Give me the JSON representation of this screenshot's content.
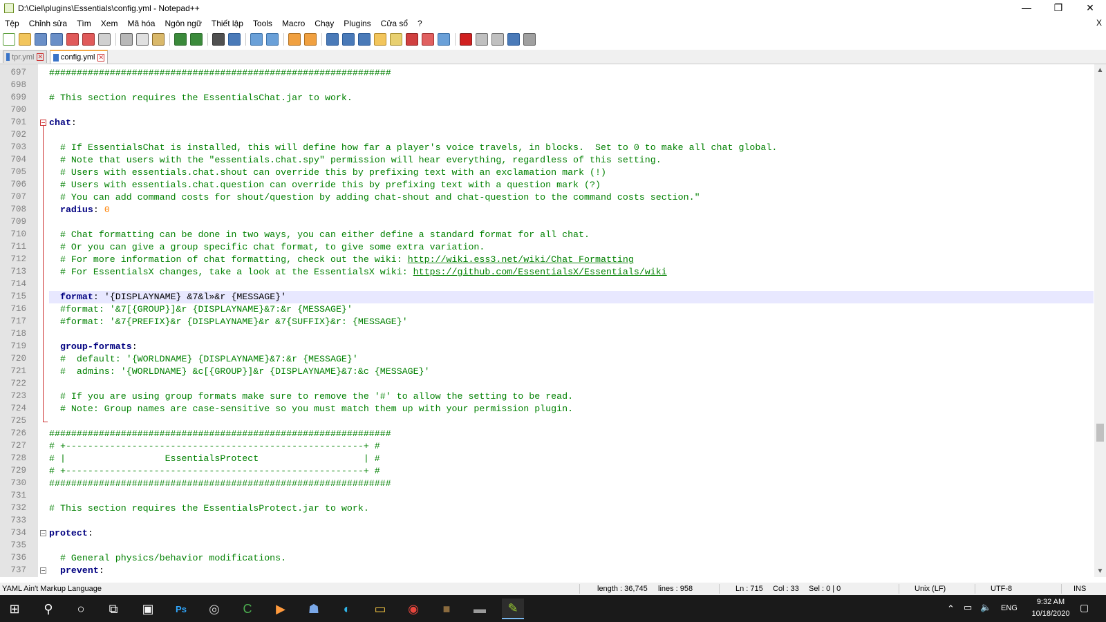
{
  "window": {
    "title": "D:\\Ciel\\plugins\\Essentials\\config.yml - Notepad++",
    "minimize": "—",
    "restore": "❐",
    "close": "✕"
  },
  "menu": {
    "items": [
      "Tệp",
      "Chỉnh sửa",
      "Tìm",
      "Xem",
      "Mã hóa",
      "Ngôn ngữ",
      "Thiết lập",
      "Tools",
      "Macro",
      "Chạy",
      "Plugins",
      "Cửa sổ",
      "?"
    ],
    "close_doc": "X"
  },
  "toolbar": {
    "buttons": [
      {
        "name": "new-file-icon",
        "color": "#ffffff",
        "border": "#5a9e3a"
      },
      {
        "name": "open-file-icon",
        "color": "#f2c55c",
        "border": "#b58a2a"
      },
      {
        "name": "save-icon",
        "color": "#6a8fc7",
        "border": "#3a5f97"
      },
      {
        "name": "save-all-icon",
        "color": "#6a8fc7",
        "border": "#3a5f97"
      },
      {
        "name": "close-file-icon",
        "color": "#e05a5a",
        "border": "#a03030"
      },
      {
        "name": "close-all-icon",
        "color": "#e05a5a",
        "border": "#a03030"
      },
      {
        "name": "print-icon",
        "color": "#d0d0d0",
        "border": "#707070"
      },
      {
        "name": "sep"
      },
      {
        "name": "cut-icon",
        "color": "#b8b8b8",
        "border": "#606060"
      },
      {
        "name": "copy-icon",
        "color": "#e0e0e0",
        "border": "#707070"
      },
      {
        "name": "paste-icon",
        "color": "#d9b86a",
        "border": "#8a6a2a"
      },
      {
        "name": "sep"
      },
      {
        "name": "undo-icon",
        "color": "#3b8a3b",
        "border": "#2a6a2a"
      },
      {
        "name": "redo-icon",
        "color": "#3b8a3b",
        "border": "#2a6a2a"
      },
      {
        "name": "sep"
      },
      {
        "name": "find-icon",
        "color": "#505050",
        "border": "#303030"
      },
      {
        "name": "replace-icon",
        "color": "#4a7ab8",
        "border": "#2a5a98"
      },
      {
        "name": "sep"
      },
      {
        "name": "zoom-in-icon",
        "color": "#6aa0d8",
        "border": "#3a70a8"
      },
      {
        "name": "zoom-out-icon",
        "color": "#6aa0d8",
        "border": "#3a70a8"
      },
      {
        "name": "sep"
      },
      {
        "name": "sync-vertical-icon",
        "color": "#f0a040",
        "border": "#b07020"
      },
      {
        "name": "sync-horizontal-icon",
        "color": "#f0a040",
        "border": "#b07020"
      },
      {
        "name": "sep"
      },
      {
        "name": "word-wrap-icon",
        "color": "#4a7ab8",
        "border": "#2a5a98"
      },
      {
        "name": "show-all-chars-icon",
        "color": "#4a7ab8",
        "border": "#2a5a98"
      },
      {
        "name": "indent-guide-icon",
        "color": "#4a7ab8",
        "border": "#2a5a98"
      },
      {
        "name": "user-language-icon",
        "color": "#f2c55c",
        "border": "#b58a2a"
      },
      {
        "name": "doc-map-icon",
        "color": "#e8d070",
        "border": "#a89030"
      },
      {
        "name": "function-list-icon",
        "color": "#d04040",
        "border": "#902020"
      },
      {
        "name": "folder-workspace-icon",
        "color": "#e06060",
        "border": "#a03030"
      },
      {
        "name": "monitoring-icon",
        "color": "#6aa0d8",
        "border": "#3a70a8"
      },
      {
        "name": "sep"
      },
      {
        "name": "record-macro-icon",
        "color": "#d02020",
        "border": "#802020"
      },
      {
        "name": "stop-record-icon",
        "color": "#c0c0c0",
        "border": "#707070"
      },
      {
        "name": "play-macro-icon",
        "color": "#c0c0c0",
        "border": "#707070"
      },
      {
        "name": "run-macro-multiple-icon",
        "color": "#4a7ab8",
        "border": "#2a5a98"
      },
      {
        "name": "save-macro-icon",
        "color": "#a0a0a0",
        "border": "#606060"
      }
    ]
  },
  "tabs": [
    {
      "label": "tpr.yml",
      "active": false
    },
    {
      "label": "config.yml",
      "active": true
    }
  ],
  "editor": {
    "lines": [
      {
        "n": "697",
        "fold": "line",
        "parts": [
          [
            "c-com",
            "##############################################################"
          ]
        ]
      },
      {
        "n": "698",
        "fold": "line",
        "parts": []
      },
      {
        "n": "699",
        "fold": "line",
        "parts": [
          [
            "c-com",
            "# This section requires the EssentialsChat.jar to work."
          ]
        ]
      },
      {
        "n": "700",
        "fold": "line",
        "parts": []
      },
      {
        "n": "701",
        "fold": "box",
        "parts": [
          [
            "c-key",
            "chat"
          ],
          [
            "c-str",
            ":"
          ]
        ]
      },
      {
        "n": "702",
        "fold": "line",
        "parts": []
      },
      {
        "n": "703",
        "fold": "line",
        "parts": [
          [
            "c-str",
            "  "
          ],
          [
            "c-com",
            "# If EssentialsChat is installed, this will define how far a player's voice travels, in blocks.  Set to 0 to make all chat global."
          ]
        ]
      },
      {
        "n": "704",
        "fold": "line",
        "parts": [
          [
            "c-str",
            "  "
          ],
          [
            "c-com",
            "# Note that users with the \"essentials.chat.spy\" permission will hear everything, regardless of this setting."
          ]
        ]
      },
      {
        "n": "705",
        "fold": "line",
        "parts": [
          [
            "c-str",
            "  "
          ],
          [
            "c-com",
            "# Users with essentials.chat.shout can override this by prefixing text with an exclamation mark (!)"
          ]
        ]
      },
      {
        "n": "706",
        "fold": "line",
        "parts": [
          [
            "c-str",
            "  "
          ],
          [
            "c-com",
            "# Users with essentials.chat.question can override this by prefixing text with a question mark (?)"
          ]
        ]
      },
      {
        "n": "707",
        "fold": "line",
        "parts": [
          [
            "c-str",
            "  "
          ],
          [
            "c-com",
            "# You can add command costs for shout/question by adding chat-shout and chat-question to the command costs section.\""
          ]
        ]
      },
      {
        "n": "708",
        "fold": "line",
        "parts": [
          [
            "c-str",
            "  "
          ],
          [
            "c-key",
            "radius"
          ],
          [
            "c-str",
            ": "
          ],
          [
            "c-num",
            "0"
          ]
        ]
      },
      {
        "n": "709",
        "fold": "line",
        "parts": []
      },
      {
        "n": "710",
        "fold": "line",
        "parts": [
          [
            "c-str",
            "  "
          ],
          [
            "c-com",
            "# Chat formatting can be done in two ways, you can either define a standard format for all chat."
          ]
        ]
      },
      {
        "n": "711",
        "fold": "line",
        "parts": [
          [
            "c-str",
            "  "
          ],
          [
            "c-com",
            "# Or you can give a group specific chat format, to give some extra variation."
          ]
        ]
      },
      {
        "n": "712",
        "fold": "line",
        "parts": [
          [
            "c-str",
            "  "
          ],
          [
            "c-com",
            "# For more information of chat formatting, check out the wiki: "
          ],
          [
            "c-url",
            "http://wiki.ess3.net/wiki/Chat_Formatting"
          ]
        ]
      },
      {
        "n": "713",
        "fold": "line",
        "parts": [
          [
            "c-str",
            "  "
          ],
          [
            "c-com",
            "# For EssentialsX changes, take a look at the EssentialsX wiki: "
          ],
          [
            "c-url",
            "https://github.com/EssentialsX/Essentials/wiki"
          ]
        ]
      },
      {
        "n": "714",
        "fold": "line",
        "parts": []
      },
      {
        "n": "715",
        "fold": "line",
        "cur": true,
        "parts": [
          [
            "c-str",
            "  "
          ],
          [
            "c-key",
            "format"
          ],
          [
            "c-str",
            ": '{DISPLAYNAME} &7&l»&r {MESSAGE}'"
          ]
        ]
      },
      {
        "n": "716",
        "fold": "line",
        "parts": [
          [
            "c-str",
            "  "
          ],
          [
            "c-com",
            "#format: '&7[{GROUP}]&r {DISPLAYNAME}&7:&r {MESSAGE}'"
          ]
        ]
      },
      {
        "n": "717",
        "fold": "line",
        "parts": [
          [
            "c-str",
            "  "
          ],
          [
            "c-com",
            "#format: '&7{PREFIX}&r {DISPLAYNAME}&r &7{SUFFIX}&r: {MESSAGE}'"
          ]
        ]
      },
      {
        "n": "718",
        "fold": "line",
        "parts": []
      },
      {
        "n": "719",
        "fold": "line",
        "parts": [
          [
            "c-str",
            "  "
          ],
          [
            "c-key",
            "group-formats"
          ],
          [
            "c-str",
            ":"
          ]
        ]
      },
      {
        "n": "720",
        "fold": "line",
        "parts": [
          [
            "c-str",
            "  "
          ],
          [
            "c-com",
            "#  default: '{WORLDNAME} {DISPLAYNAME}&7:&r {MESSAGE}'"
          ]
        ]
      },
      {
        "n": "721",
        "fold": "line",
        "parts": [
          [
            "c-str",
            "  "
          ],
          [
            "c-com",
            "#  admins: '{WORLDNAME} &c[{GROUP}]&r {DISPLAYNAME}&7:&c {MESSAGE}'"
          ]
        ]
      },
      {
        "n": "722",
        "fold": "line",
        "parts": []
      },
      {
        "n": "723",
        "fold": "line",
        "parts": [
          [
            "c-str",
            "  "
          ],
          [
            "c-com",
            "# If you are using group formats make sure to remove the '#' to allow the setting to be read."
          ]
        ]
      },
      {
        "n": "724",
        "fold": "line",
        "parts": [
          [
            "c-str",
            "  "
          ],
          [
            "c-com",
            "# Note: Group names are case-sensitive so you must match them up with your permission plugin."
          ]
        ]
      },
      {
        "n": "725",
        "fold": "end",
        "parts": []
      },
      {
        "n": "726",
        "fold": "none",
        "parts": [
          [
            "c-com",
            "##############################################################"
          ]
        ]
      },
      {
        "n": "727",
        "fold": "none",
        "parts": [
          [
            "c-com",
            "# +------------------------------------------------------+ #"
          ]
        ]
      },
      {
        "n": "728",
        "fold": "none",
        "parts": [
          [
            "c-com",
            "# |                  EssentialsProtect                   | #"
          ]
        ]
      },
      {
        "n": "729",
        "fold": "none",
        "parts": [
          [
            "c-com",
            "# +------------------------------------------------------+ #"
          ]
        ]
      },
      {
        "n": "730",
        "fold": "none",
        "parts": [
          [
            "c-com",
            "##############################################################"
          ]
        ]
      },
      {
        "n": "731",
        "fold": "none",
        "parts": []
      },
      {
        "n": "732",
        "fold": "none",
        "parts": [
          [
            "c-com",
            "# This section requires the EssentialsProtect.jar to work."
          ]
        ]
      },
      {
        "n": "733",
        "fold": "none",
        "parts": []
      },
      {
        "n": "734",
        "fold": "graybox",
        "parts": [
          [
            "c-key",
            "protect"
          ],
          [
            "c-str",
            ":"
          ]
        ]
      },
      {
        "n": "735",
        "fold": "none",
        "parts": []
      },
      {
        "n": "736",
        "fold": "none",
        "parts": [
          [
            "c-str",
            "  "
          ],
          [
            "c-com",
            "# General physics/behavior modifications."
          ]
        ]
      },
      {
        "n": "737",
        "fold": "graybox",
        "parts": [
          [
            "c-str",
            "  "
          ],
          [
            "c-key",
            "prevent"
          ],
          [
            "c-str",
            ":"
          ]
        ]
      }
    ]
  },
  "status": {
    "language": "YAML Ain't Markup Language",
    "length": "length : 36,745",
    "lines": "lines : 958",
    "ln": "Ln : 715",
    "col": "Col : 33",
    "sel": "Sel : 0 | 0",
    "eol": "Unix (LF)",
    "encoding": "UTF-8",
    "mode": "INS"
  },
  "taskbar": {
    "apps": [
      {
        "name": "start-icon",
        "glyph": "⊞",
        "color": "#ffffff"
      },
      {
        "name": "search-icon",
        "glyph": "⚲",
        "color": "#ffffff"
      },
      {
        "name": "cortana-icon",
        "glyph": "○",
        "color": "#ffffff"
      },
      {
        "name": "task-view-icon",
        "glyph": "⧉",
        "color": "#ffffff"
      },
      {
        "name": "store-icon",
        "glyph": "▣",
        "color": "#f4f4f4"
      },
      {
        "name": "photoshop-icon",
        "glyph": "Ps",
        "color": "#31a8ff"
      },
      {
        "name": "obs-icon",
        "glyph": "◎",
        "color": "#d0d0d0"
      },
      {
        "name": "camtasia-icon",
        "glyph": "C",
        "color": "#4caf50"
      },
      {
        "name": "video-player-icon",
        "glyph": "▶",
        "color": "#ff9a3c"
      },
      {
        "name": "people-icon",
        "glyph": "☗",
        "color": "#7aa8e8"
      },
      {
        "name": "edge-icon",
        "glyph": "◐",
        "color": "#2fb5e8"
      },
      {
        "name": "file-explorer-icon",
        "glyph": "▭",
        "color": "#f4c542"
      },
      {
        "name": "chrome-icon",
        "glyph": "◉",
        "color": "#e8453c"
      },
      {
        "name": "minecraft-icon",
        "glyph": "■",
        "color": "#8b6b3e"
      },
      {
        "name": "terminal-icon",
        "glyph": "▬",
        "color": "#9a9a9a"
      },
      {
        "name": "notepadpp-icon",
        "glyph": "✎",
        "color": "#9acd32"
      }
    ],
    "lang": "ENG",
    "time": "9:32 AM",
    "date": "10/18/2020"
  }
}
